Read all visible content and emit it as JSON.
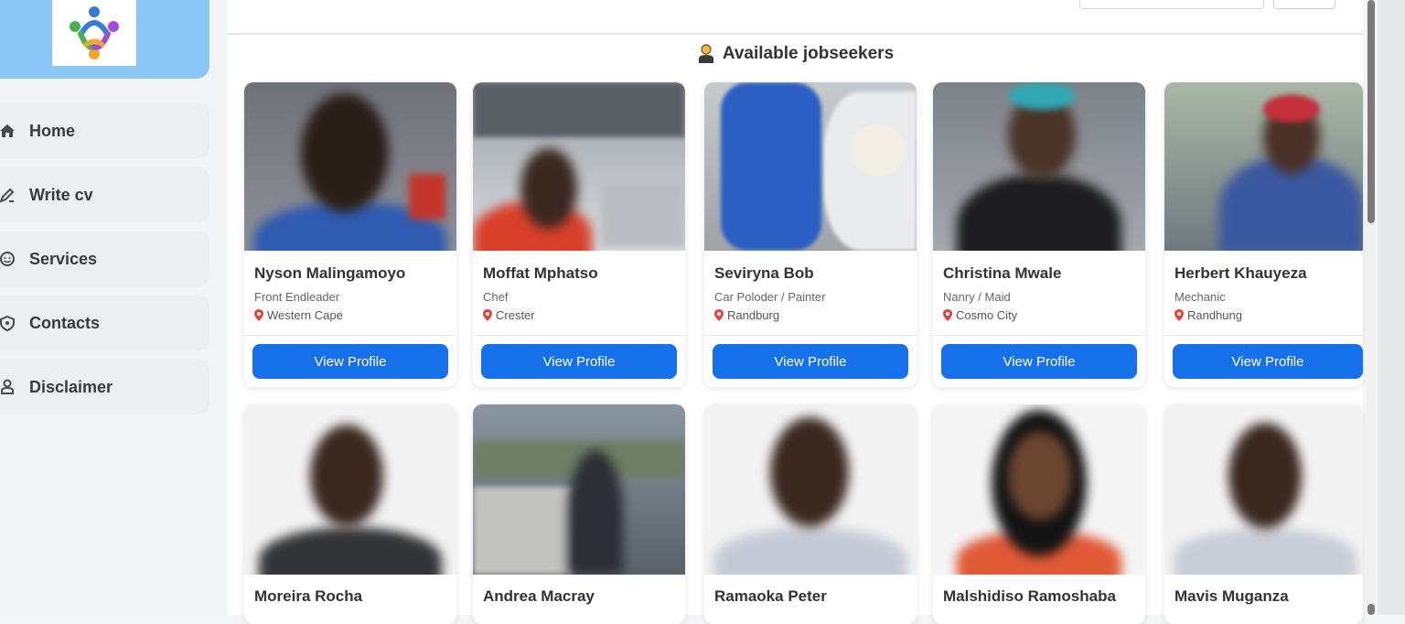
{
  "colors": {
    "accent": "#1670ea",
    "sidebar_logo_bg": "#8cc8f5",
    "pin": "#e2453c"
  },
  "sidebar": {
    "items": [
      {
        "label": "Home",
        "icon": "home-icon"
      },
      {
        "label": "Write cv",
        "icon": "pen-icon"
      },
      {
        "label": "Services",
        "icon": "services-icon"
      },
      {
        "label": "Contacts",
        "icon": "contacts-icon"
      },
      {
        "label": "Disclaimer",
        "icon": "person-icon"
      }
    ]
  },
  "section": {
    "title": "Available jobseekers",
    "icon": "person-icon"
  },
  "cards": [
    {
      "name": "Nyson Malingamoyo",
      "job": "Front Endleader",
      "location": "Western Cape",
      "button": "View Profile"
    },
    {
      "name": "Moffat Mphatso",
      "job": "Chef",
      "location": "Crester",
      "button": "View Profile"
    },
    {
      "name": "Seviryna Bob",
      "job": "Car Poloder / Painter",
      "location": "Randburg",
      "button": "View Profile"
    },
    {
      "name": "Christina Mwale",
      "job": "Nanry / Maid",
      "location": "Cosmo City",
      "button": "View Profile"
    },
    {
      "name": "Herbert Khauyeza",
      "job": "Mechanic",
      "location": "Randhung",
      "button": "View Profile"
    },
    {
      "name": "Moreira Rocha"
    },
    {
      "name": "Andrea Macray"
    },
    {
      "name": "Ramaoka Peter"
    },
    {
      "name": "Malshidiso Ramoshaba"
    },
    {
      "name": "Mavis Muganza"
    }
  ]
}
